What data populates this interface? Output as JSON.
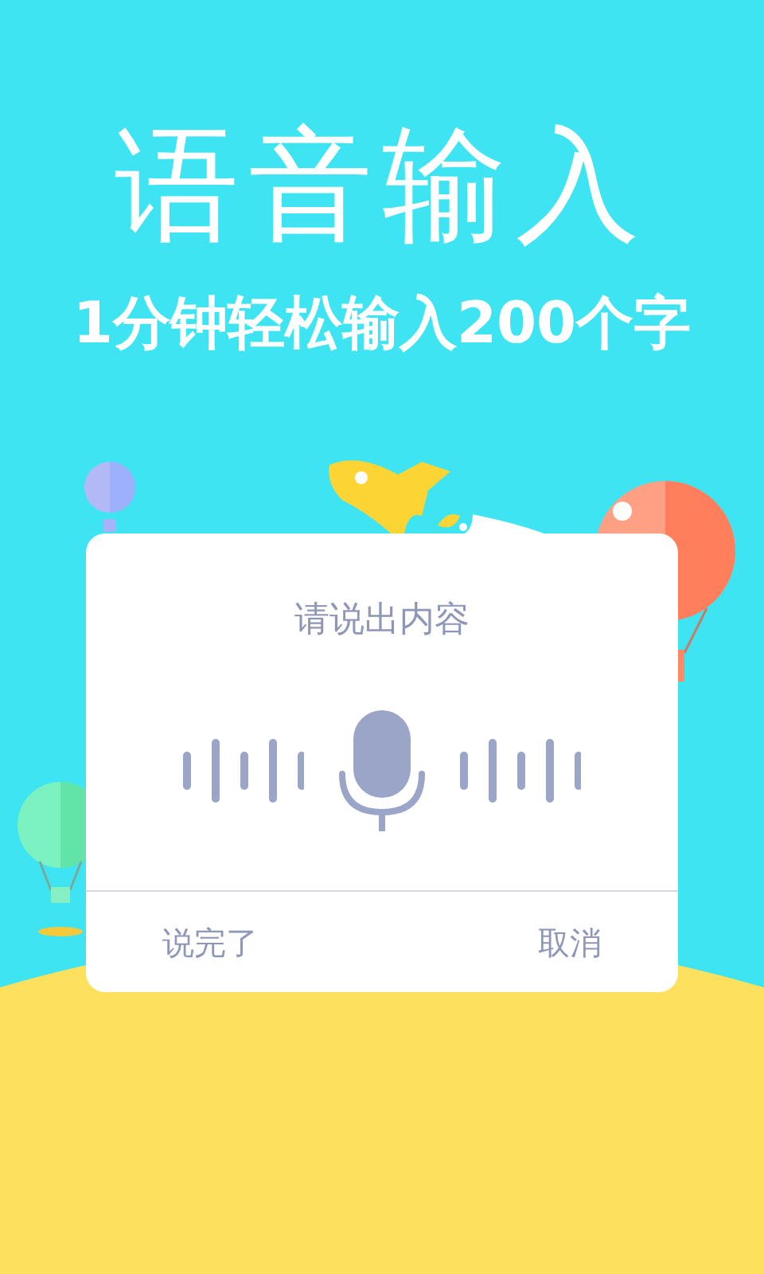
{
  "headline": "语音输入",
  "subtitle": "1分钟轻松输入200个字",
  "dialog": {
    "prompt": "请说出内容",
    "buttons": [
      {
        "label": "说完了"
      },
      {
        "label": "取消"
      }
    ]
  }
}
